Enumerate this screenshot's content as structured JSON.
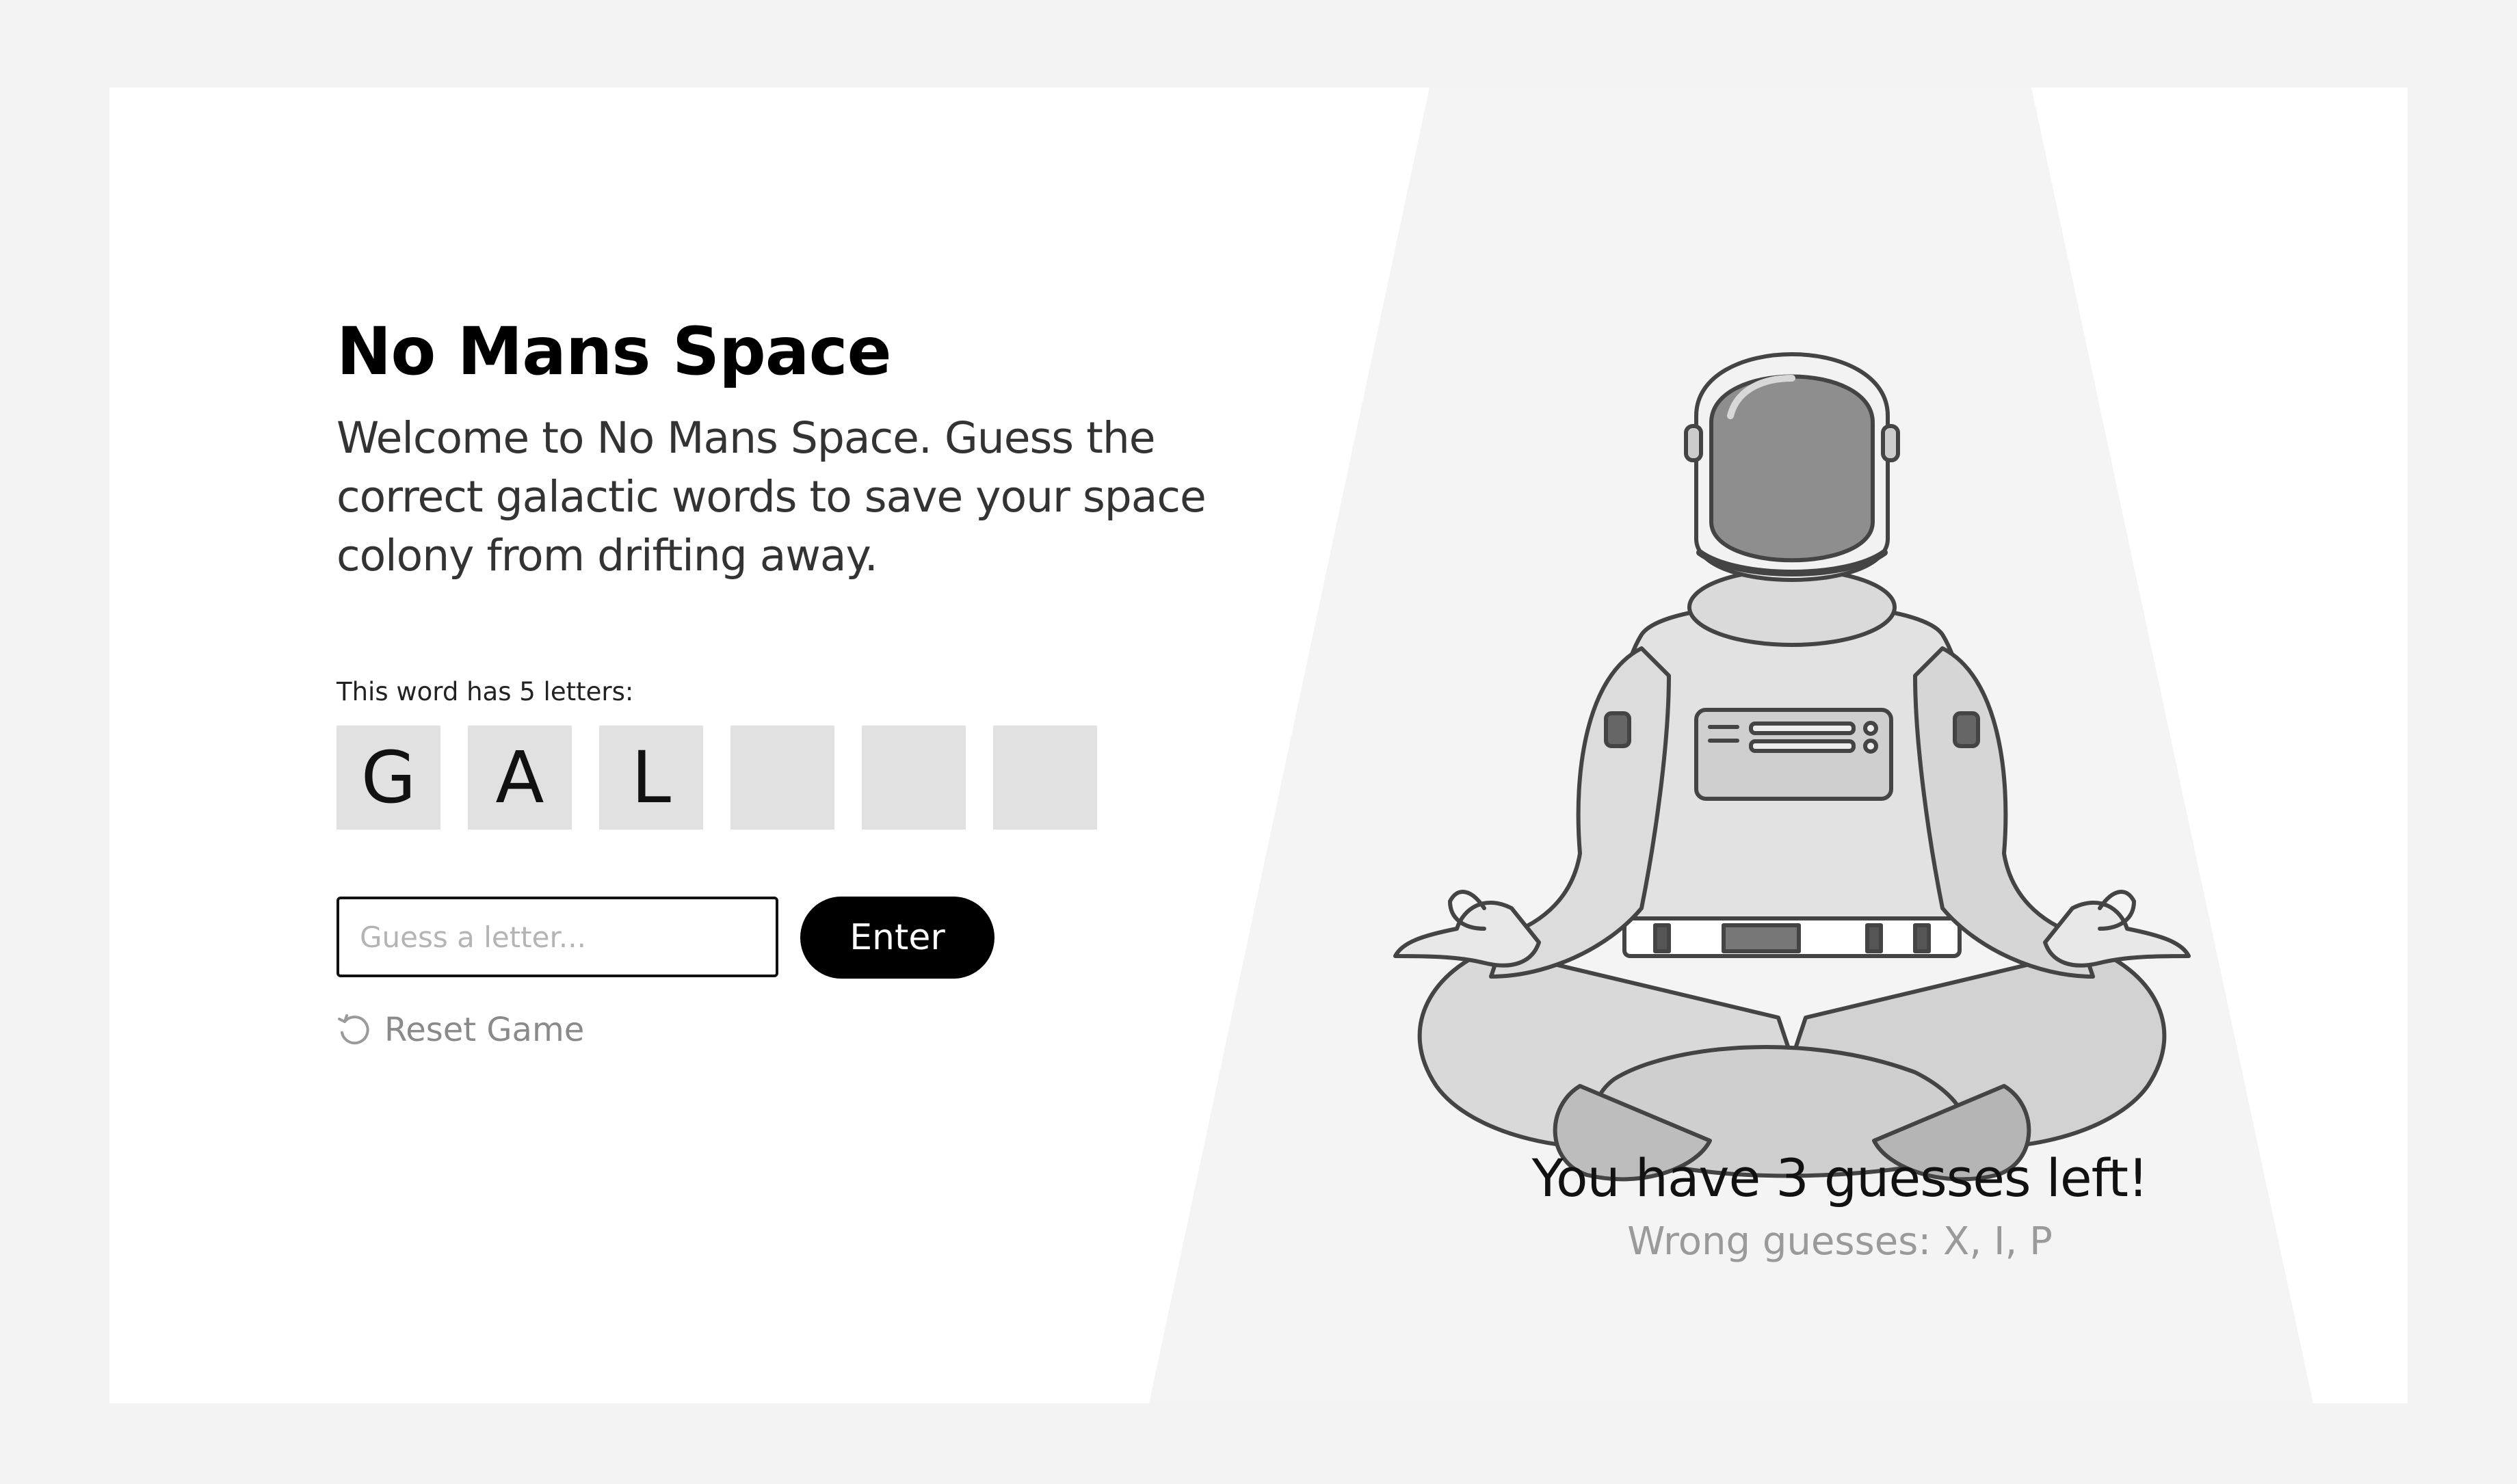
{
  "game": {
    "title": "No Mans Space",
    "intro": "Welcome to No Mans Space. Guess the correct galactic words to save your space colony from drifting away.",
    "word_hint": "This word has 5 letters:",
    "tiles": [
      "G",
      "A",
      "L",
      "",
      "",
      ""
    ],
    "input_placeholder": "Guess a letter...",
    "enter_label": "Enter",
    "reset_label": "Reset Game",
    "reset_icon": "reset-icon",
    "guesses_left": "You have 3 guesses left!",
    "wrong_guesses": "Wrong guesses: X, I, P"
  },
  "illustration": {
    "subject": "astronaut-meditating"
  },
  "colors": {
    "page_bg": "#f3f3f3",
    "card_bg": "#ffffff",
    "beam": "#f4f4f4",
    "tile_bg": "#e1e1e1",
    "button_bg": "#000000",
    "muted_text": "#9a9a9a"
  }
}
